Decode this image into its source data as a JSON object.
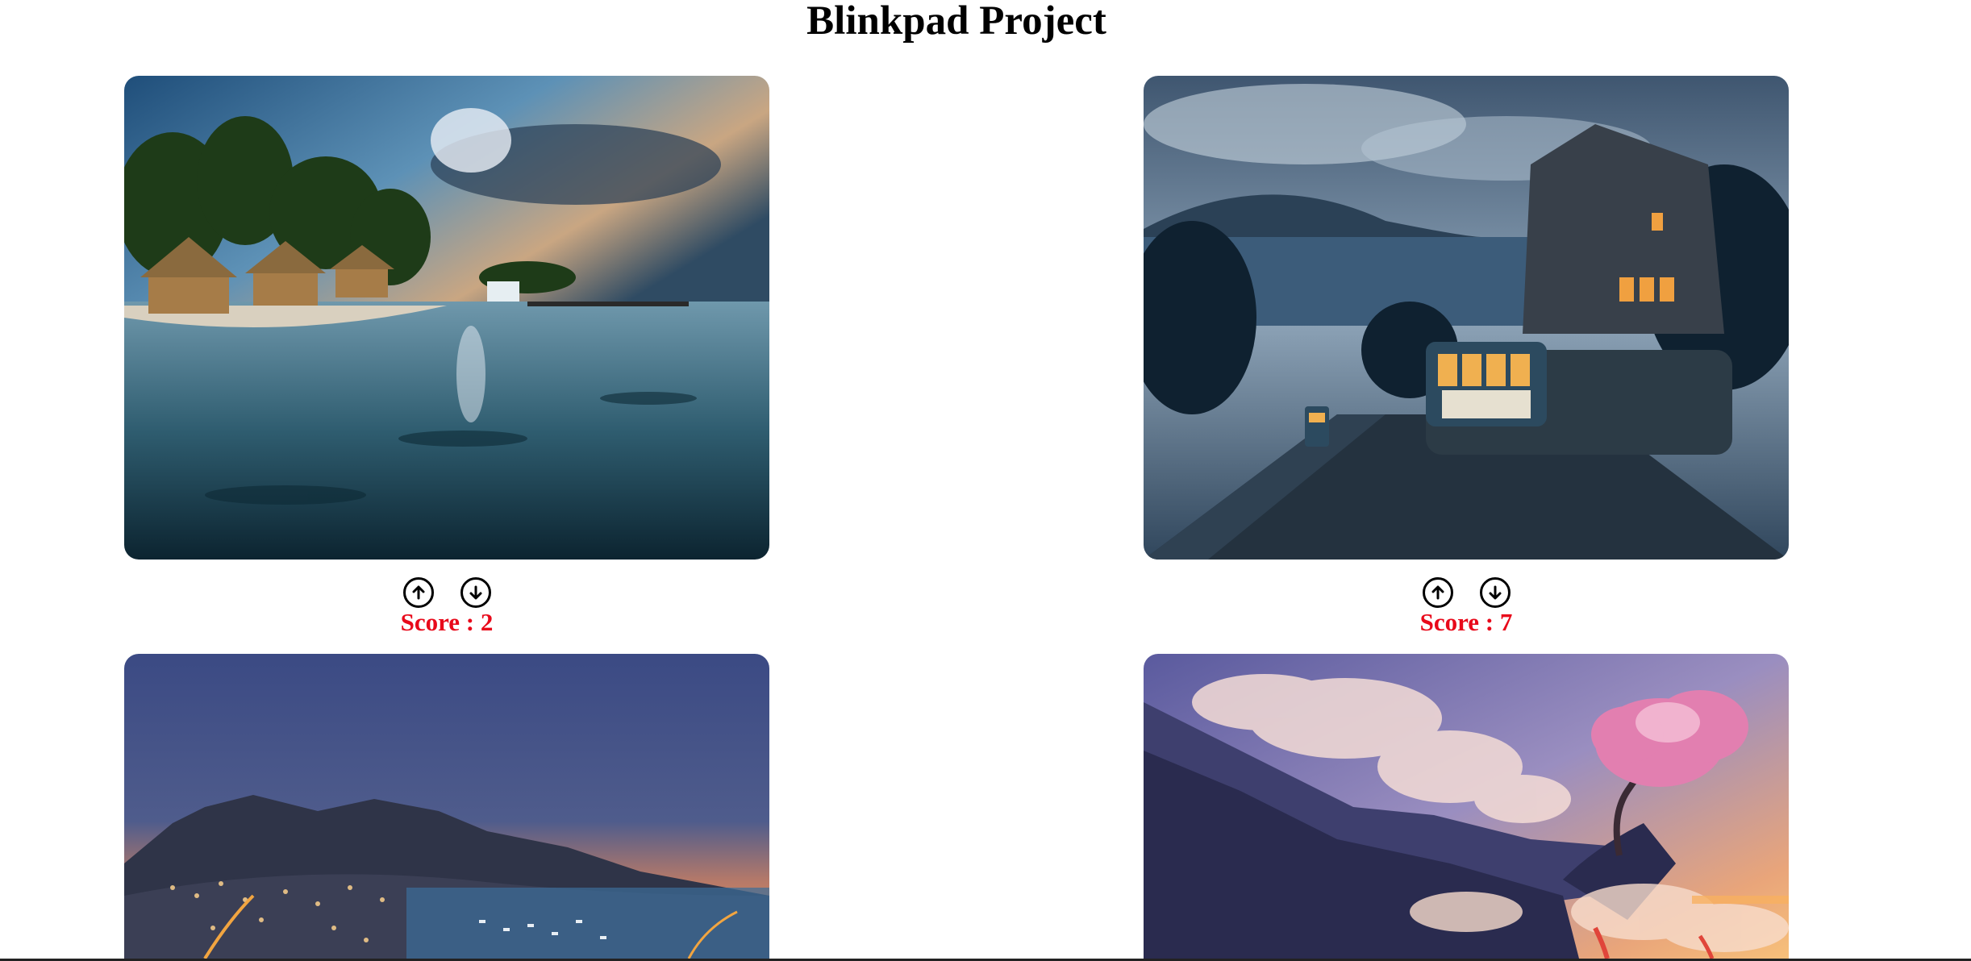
{
  "header": {
    "title": "Blinkpad Project"
  },
  "posts": [
    {
      "image_name": "tropical-beach-huts",
      "score_label": "Score : 2",
      "upvote_icon": "arrow-up-circle-icon",
      "downvote_icon": "arrow-down-circle-icon"
    },
    {
      "image_name": "victorian-town-cable-car",
      "score_label": "Score : 7",
      "upvote_icon": "arrow-up-circle-icon",
      "downvote_icon": "arrow-down-circle-icon"
    },
    {
      "image_name": "coastal-city-dusk"
    },
    {
      "image_name": "cherry-tree-cliffs"
    }
  ],
  "colors": {
    "score": "#e8091a",
    "background": "#ffffff"
  }
}
